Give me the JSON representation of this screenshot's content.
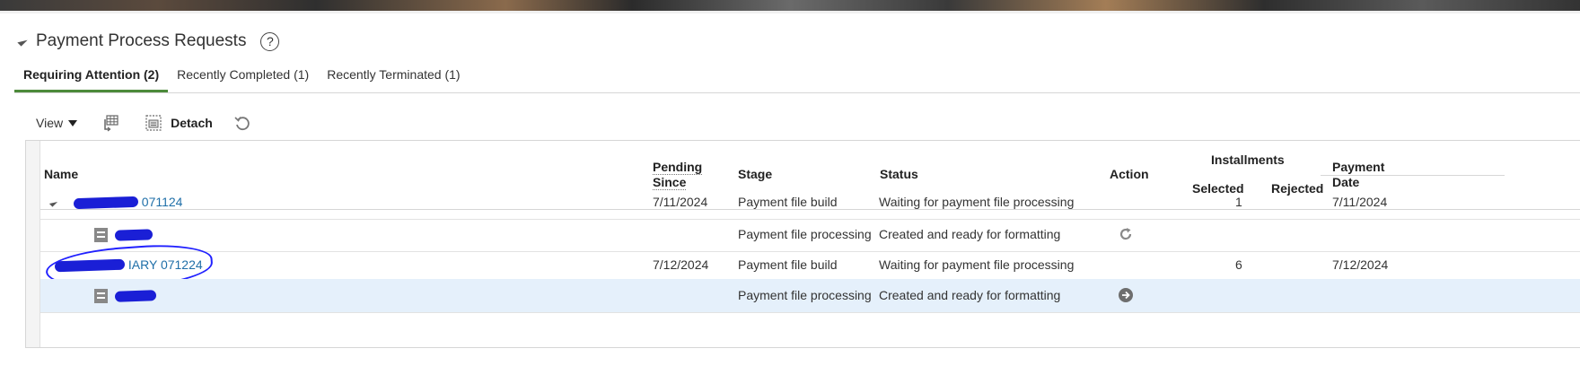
{
  "panel": {
    "title": "Payment Process Requests",
    "help_symbol": "?"
  },
  "tabs": [
    {
      "label": "Requiring Attention (2)",
      "active": true
    },
    {
      "label": "Recently Completed (1)",
      "active": false
    },
    {
      "label": "Recently Terminated (1)",
      "active": false
    }
  ],
  "toolbar": {
    "view_label": "View",
    "detach_label": "Detach",
    "icons": [
      "column-freeze-icon",
      "detach-icon",
      "refresh-icon"
    ]
  },
  "table": {
    "headers": {
      "name": "Name",
      "pending_since": [
        "Pending",
        "Since"
      ],
      "stage": "Stage",
      "status": "Status",
      "action": "Action",
      "installments": "Installments",
      "selected": "Selected",
      "rejected": "Rejected",
      "payment_date": [
        "Payment",
        "Date"
      ]
    },
    "rows": [
      {
        "name_visible": "071124",
        "pending_since": "7/11/2024",
        "stage": "Payment file build",
        "status": "Waiting for payment file processing",
        "selected": "1",
        "rejected": "",
        "payment_date": "7/11/2024",
        "action_icon": ""
      },
      {
        "name_visible": "",
        "pending_since": "",
        "stage": "Payment file processing",
        "status": "Created and ready for formatting",
        "selected": "",
        "rejected": "",
        "payment_date": "",
        "action_icon": "reload-icon"
      },
      {
        "name_visible": "IARY 071224",
        "pending_since": "7/12/2024",
        "stage": "Payment file build",
        "status": "Waiting for payment file processing",
        "selected": "6",
        "rejected": "",
        "payment_date": "7/12/2024",
        "action_icon": ""
      },
      {
        "name_visible": "",
        "pending_since": "",
        "stage": "Payment file processing",
        "status": "Created and ready for formatting",
        "selected": "",
        "rejected": "",
        "payment_date": "",
        "action_icon": "go-arrow-icon"
      }
    ]
  },
  "colors": {
    "link": "#1f6fa8",
    "tab_underline": "#4c8a3a",
    "selected_row": "#e5f0fb",
    "annotation": "#2020ff"
  }
}
